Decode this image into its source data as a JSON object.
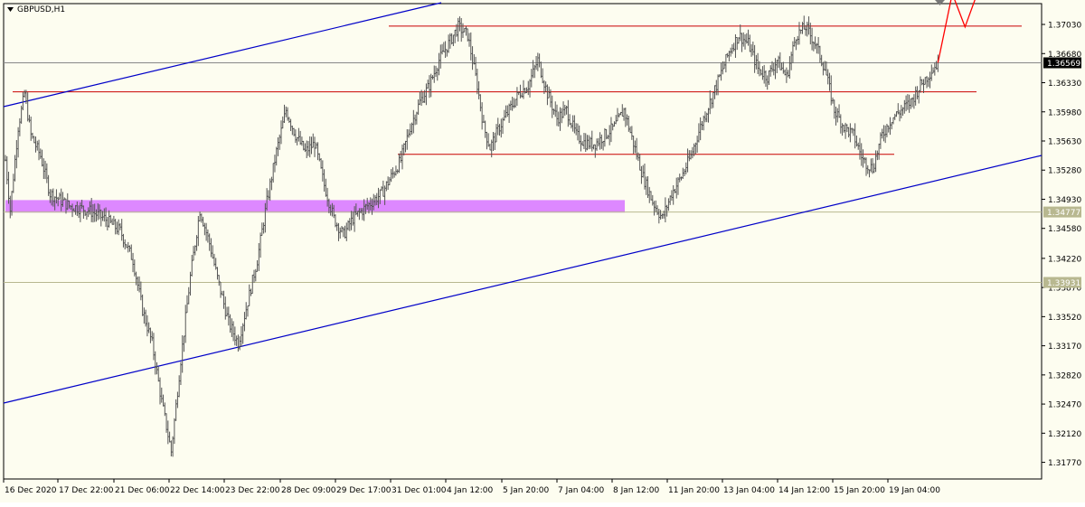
{
  "window": {
    "symbol_label": "GBPUSD,H1",
    "menu_icon": "triangle-down-icon"
  },
  "colors": {
    "background": "#fdfdf0",
    "bars": "#555555",
    "channel": "#0000c8",
    "resistance": "#c80000",
    "zone": "#dd88ff",
    "level": "#b8b890",
    "projection": "#ff0000"
  },
  "chart_data": {
    "type": "ohlc",
    "title": "GBPUSD,H1",
    "xlabel": "",
    "ylabel": "",
    "ylim": [
      1.3157,
      1.3728
    ],
    "x_ticks": [
      "16 Dec 2020",
      "17 Dec 22:00",
      "21 Dec 06:00",
      "22 Dec 14:00",
      "23 Dec 22:00",
      "28 Dec 09:00",
      "29 Dec 17:00",
      "31 Dec 01:00",
      "4 Jan 12:00",
      "5 Jan 20:00",
      "7 Jan 04:00",
      "8 Jan 12:00",
      "11 Jan 20:00",
      "13 Jan 04:00",
      "14 Jan 12:00",
      "15 Jan 20:00",
      "19 Jan 04:00"
    ],
    "y_ticks": [
      "1.37030",
      "1.36680",
      "1.36330",
      "1.35980",
      "1.35630",
      "1.35280",
      "1.34930",
      "1.34580",
      "1.34220",
      "1.33870",
      "1.33520",
      "1.33170",
      "1.32820",
      "1.32470",
      "1.32120",
      "1.31770"
    ],
    "price_labels": [
      {
        "text": "1.36569",
        "value": 1.36569,
        "style": "current"
      },
      {
        "text": "1.34777",
        "value": 1.34777,
        "style": "level"
      },
      {
        "text": "1.33931",
        "value": 1.33931,
        "style": "level"
      }
    ],
    "horizontal_levels": [
      {
        "name": "resistance-top",
        "value": 1.3701,
        "from": "31 Dec 01:00",
        "to": "end"
      },
      {
        "name": "resistance-middle",
        "value": 1.3622,
        "from": "16 Dec 2020",
        "to": "end"
      },
      {
        "name": "support-range-bottom",
        "value": 1.3547,
        "from": "31 Dec 01:00",
        "to": "15 Jan 20:00"
      }
    ],
    "demand_zone": {
      "from_value": 1.3477,
      "to_value": 1.3492,
      "from": "16 Dec 2020",
      "to": "8 Jan 12:00"
    },
    "channel_lines": [
      {
        "name": "channel-upper",
        "color": "blue"
      },
      {
        "name": "channel-lower",
        "color": "blue"
      }
    ],
    "price_path": [
      [
        0,
        1.354
      ],
      [
        3,
        1.348
      ],
      [
        8,
        1.358
      ],
      [
        12,
        1.362
      ],
      [
        16,
        1.357
      ],
      [
        22,
        1.3545
      ],
      [
        28,
        1.35
      ],
      [
        40,
        1.3485
      ],
      [
        52,
        1.348
      ],
      [
        62,
        1.347
      ],
      [
        72,
        1.3455
      ],
      [
        80,
        1.342
      ],
      [
        86,
        1.336
      ],
      [
        92,
        1.332
      ],
      [
        98,
        1.325
      ],
      [
        104,
        1.319
      ],
      [
        110,
        1.33
      ],
      [
        116,
        1.34
      ],
      [
        122,
        1.348
      ],
      [
        128,
        1.344
      ],
      [
        134,
        1.339
      ],
      [
        140,
        1.3345
      ],
      [
        146,
        1.332
      ],
      [
        152,
        1.337
      ],
      [
        158,
        1.342
      ],
      [
        164,
        1.349
      ],
      [
        170,
        1.355
      ],
      [
        176,
        1.36
      ],
      [
        182,
        1.357
      ],
      [
        188,
        1.355
      ],
      [
        194,
        1.356
      ],
      [
        200,
        1.351
      ],
      [
        206,
        1.347
      ],
      [
        212,
        1.345
      ],
      [
        218,
        1.347
      ],
      [
        224,
        1.348
      ],
      [
        230,
        1.349
      ],
      [
        236,
        1.35
      ],
      [
        242,
        1.352
      ],
      [
        248,
        1.354
      ],
      [
        254,
        1.358
      ],
      [
        260,
        1.361
      ],
      [
        266,
        1.363
      ],
      [
        272,
        1.366
      ],
      [
        278,
        1.368
      ],
      [
        284,
        1.37
      ],
      [
        290,
        1.369
      ],
      [
        296,
        1.363
      ],
      [
        300,
        1.358
      ],
      [
        304,
        1.3555
      ],
      [
        310,
        1.358
      ],
      [
        316,
        1.36
      ],
      [
        322,
        1.362
      ],
      [
        328,
        1.363
      ],
      [
        334,
        1.366
      ],
      [
        340,
        1.362
      ],
      [
        346,
        1.359
      ],
      [
        352,
        1.36
      ],
      [
        358,
        1.357
      ],
      [
        364,
        1.356
      ],
      [
        370,
        1.356
      ],
      [
        376,
        1.357
      ],
      [
        382,
        1.358
      ],
      [
        388,
        1.36
      ],
      [
        394,
        1.356
      ],
      [
        400,
        1.352
      ],
      [
        406,
        1.349
      ],
      [
        412,
        1.347
      ],
      [
        418,
        1.35
      ],
      [
        424,
        1.352
      ],
      [
        430,
        1.3545
      ],
      [
        436,
        1.358
      ],
      [
        442,
        1.361
      ],
      [
        448,
        1.364
      ],
      [
        454,
        1.367
      ],
      [
        460,
        1.369
      ],
      [
        466,
        1.368
      ],
      [
        472,
        1.365
      ],
      [
        478,
        1.364
      ],
      [
        484,
        1.366
      ],
      [
        490,
        1.364
      ],
      [
        496,
        1.369
      ],
      [
        502,
        1.37
      ],
      [
        508,
        1.368
      ],
      [
        514,
        1.365
      ],
      [
        520,
        1.36
      ],
      [
        526,
        1.358
      ],
      [
        532,
        1.357
      ],
      [
        538,
        1.354
      ],
      [
        544,
        1.353
      ],
      [
        550,
        1.357
      ],
      [
        556,
        1.359
      ],
      [
        562,
        1.36
      ],
      [
        568,
        1.361
      ],
      [
        574,
        1.363
      ],
      [
        580,
        1.3645
      ],
      [
        585,
        1.3657
      ]
    ],
    "projection_path": [
      [
        585,
        1.3657
      ],
      [
        594,
        1.374
      ],
      [
        602,
        1.37
      ],
      [
        610,
        1.3742
      ]
    ],
    "grid": false,
    "legend": "none"
  }
}
